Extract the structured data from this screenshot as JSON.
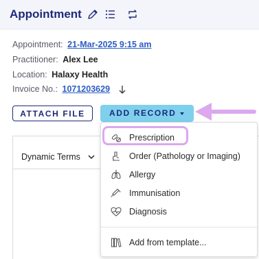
{
  "header": {
    "title": "Appointment",
    "icons": [
      "pencil-icon",
      "list-icon",
      "repeat-icon"
    ]
  },
  "details": {
    "appointment_label": "Appointment:",
    "appointment_value": "21-Mar-2025 9:15 am",
    "practitioner_label": "Practitioner:",
    "practitioner_value": "Alex Lee",
    "location_label": "Location:",
    "location_value": "Halaxy Health",
    "invoice_label": "Invoice No.:",
    "invoice_value": "1071203629"
  },
  "buttons": {
    "attach_label": "ATTACH FILE",
    "add_record_label": "ADD RECORD"
  },
  "panel": {
    "dynamic_terms_label": "Dynamic Terms"
  },
  "menu": {
    "items": [
      {
        "label": "Prescription",
        "icon": "pill-icon"
      },
      {
        "label": "Order (Pathology or Imaging)",
        "icon": "microscope-icon"
      },
      {
        "label": "Allergy",
        "icon": "lungs-icon"
      },
      {
        "label": "Immunisation",
        "icon": "syringe-icon"
      },
      {
        "label": "Diagnosis",
        "icon": "heart-pulse-icon"
      }
    ],
    "template_item": {
      "label": "Add from template...",
      "icon": "books-icon"
    }
  },
  "colors": {
    "brand_navy": "#1e2a78",
    "link_blue": "#2c5cc5",
    "add_button_bg": "#7fd0ec",
    "highlight_purple": "#dca8ee"
  }
}
